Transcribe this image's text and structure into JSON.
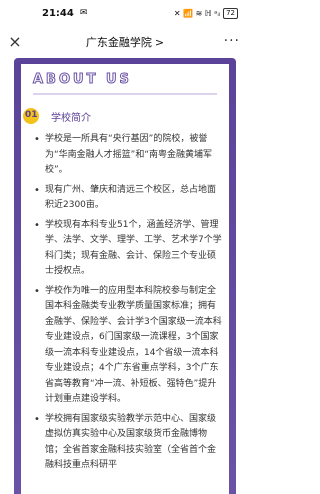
{
  "status": {
    "time": "21:44",
    "icons": "✉",
    "right": "✕ 📶 ≋ ℍ ᵃᵢₗ",
    "battery": "72"
  },
  "nav": {
    "title": "广东金融学院",
    "chevron": ">",
    "close_icon": "×",
    "more_icon": "···"
  },
  "page": {
    "about_title": "ABOUT US",
    "section_number": "01",
    "section_title": "学校简介",
    "items": [
      "学校是一所具有“央行基因”的院校，被誉为“华南金融人才摇篮”和“南粤金融黄埔军校”。",
      "现有广州、肇庆和清远三个校区，总占地面积近2300亩。",
      "学校现有本科专业51个，涵盖经济学、管理学、法学、文学、理学、工学、艺术学7个学科门类；现有金融、会计、保险三个专业硕士授权点。",
      "学校作为唯一的应用型本科院校参与制定全国本科金融类专业教学质量国家标准；拥有金融学、保险学、会计学3个国家级一流本科专业建设点，6门国家级一流课程，3个国家级一流本科专业建设点，14个省级一流本科专业建设点；4个广东省重点学科，3个广东省高等教育“冲一流、补短板、强特色”提升计划重点建设学科。",
      "学校拥有国家级实验教学示范中心、国家级虚拟仿真实验中心及国家级货币金融博物馆；全省首家金融科技实验室（全省首个金融科技重点科研平"
    ]
  }
}
